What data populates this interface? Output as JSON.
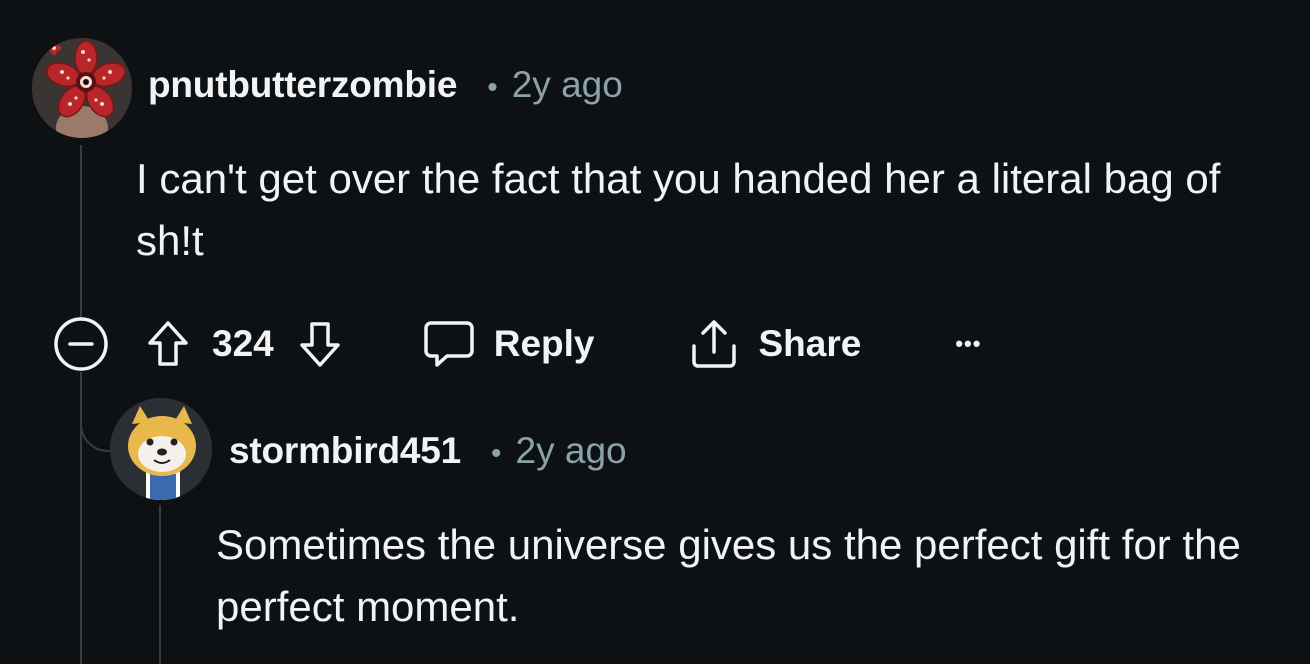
{
  "comment": {
    "username": "pnutbutterzombie",
    "separator": "•",
    "time": "2y ago",
    "text": "I can't get over the fact that you handed her a literal bag of sh!t",
    "votes": "324",
    "actions": {
      "reply_label": "Reply",
      "share_label": "Share",
      "more_label": "•••"
    }
  },
  "reply": {
    "username": "stormbird451",
    "separator": "•",
    "time": "2y ago",
    "text": "Sometimes the universe gives us the perfect gift for the perfect moment."
  },
  "icons": {
    "collapse": "collapse-icon",
    "upvote": "upvote-arrow-icon",
    "downvote": "downvote-arrow-icon",
    "reply": "speech-bubble-icon",
    "share": "share-upload-icon",
    "more": "more-options-icon"
  },
  "colors": {
    "background": "#0e1113",
    "text": "#f2f3f5",
    "meta": "#8ba2ad",
    "thread_line": "#3a3d40"
  }
}
